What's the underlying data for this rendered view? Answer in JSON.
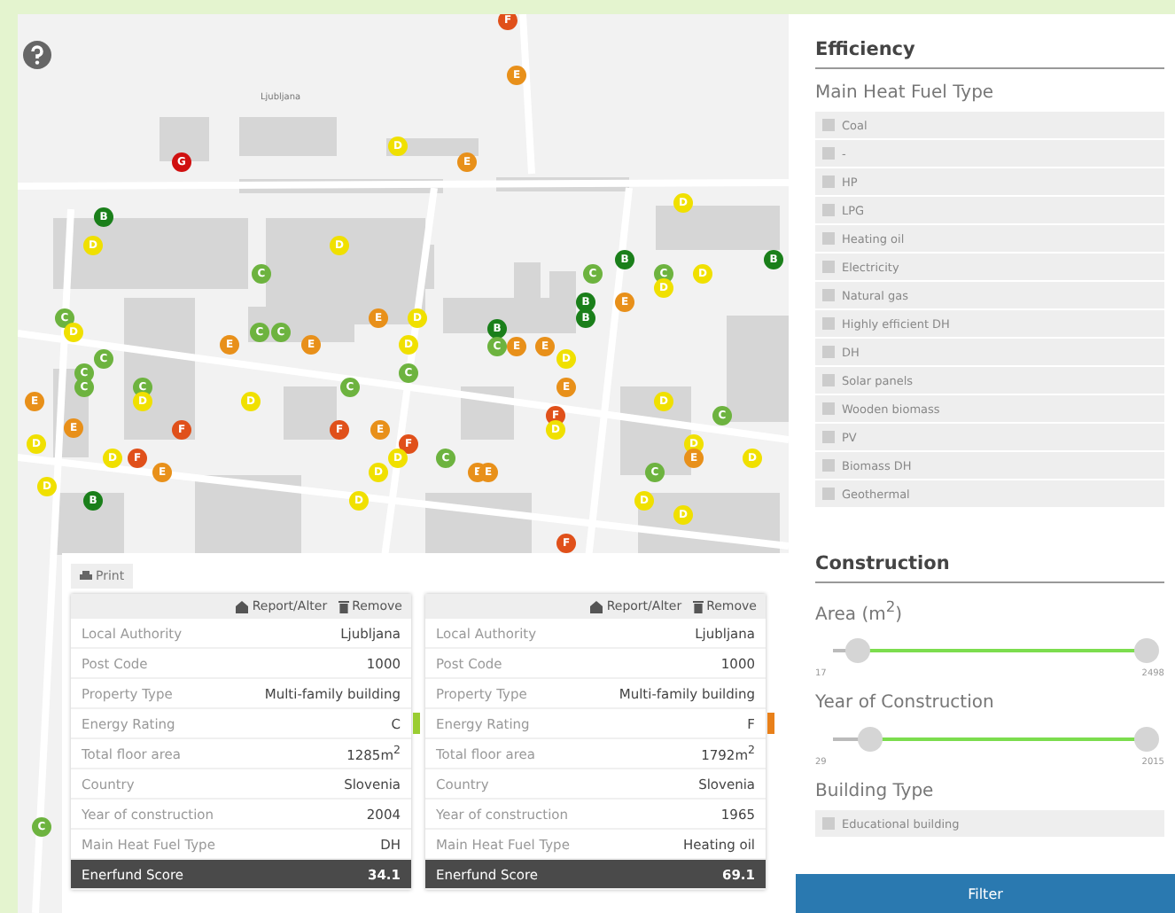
{
  "map": {
    "place_label": "Ljubljana",
    "markers": [
      {
        "label": "F",
        "color": "#e0501a"
      },
      {
        "label": "E",
        "color": "#e8901a"
      },
      {
        "label": "D",
        "color": "#f0e000"
      },
      {
        "label": "G",
        "color": "#d01010"
      },
      {
        "label": "E",
        "color": "#e8901a"
      },
      {
        "label": "D",
        "color": "#f0e000"
      },
      {
        "label": "B",
        "color": "#1a7f1a"
      },
      {
        "label": "D",
        "color": "#f0e000"
      },
      {
        "label": "D",
        "color": "#f0e000"
      },
      {
        "label": "B",
        "color": "#1a7f1a"
      },
      {
        "label": "B",
        "color": "#1a7f1a"
      },
      {
        "label": "C",
        "color": "#6db33f"
      },
      {
        "label": "C",
        "color": "#6db33f"
      },
      {
        "label": "C",
        "color": "#6db33f"
      },
      {
        "label": "D",
        "color": "#f0e000"
      },
      {
        "label": "D",
        "color": "#f0e000"
      },
      {
        "label": "B",
        "color": "#1a7f1a"
      },
      {
        "label": "E",
        "color": "#e8901a"
      },
      {
        "label": "C",
        "color": "#6db33f"
      },
      {
        "label": "E",
        "color": "#e8901a"
      },
      {
        "label": "D",
        "color": "#f0e000"
      },
      {
        "label": "B",
        "color": "#1a7f1a"
      },
      {
        "label": "B",
        "color": "#1a7f1a"
      },
      {
        "label": "D",
        "color": "#f0e000"
      },
      {
        "label": "C",
        "color": "#6db33f"
      },
      {
        "label": "C",
        "color": "#6db33f"
      },
      {
        "label": "E",
        "color": "#e8901a"
      },
      {
        "label": "E",
        "color": "#e8901a"
      },
      {
        "label": "D",
        "color": "#f0e000"
      },
      {
        "label": "C",
        "color": "#6db33f"
      },
      {
        "label": "E",
        "color": "#e8901a"
      },
      {
        "label": "E",
        "color": "#e8901a"
      },
      {
        "label": "C",
        "color": "#6db33f"
      },
      {
        "label": "D",
        "color": "#f0e000"
      },
      {
        "label": "C",
        "color": "#6db33f"
      },
      {
        "label": "C",
        "color": "#6db33f"
      },
      {
        "label": "C",
        "color": "#6db33f"
      },
      {
        "label": "C",
        "color": "#6db33f"
      },
      {
        "label": "C",
        "color": "#6db33f"
      },
      {
        "label": "E",
        "color": "#e8901a"
      },
      {
        "label": "E",
        "color": "#e8901a"
      },
      {
        "label": "D",
        "color": "#f0e000"
      },
      {
        "label": "D",
        "color": "#f0e000"
      },
      {
        "label": "D",
        "color": "#f0e000"
      },
      {
        "label": "F",
        "color": "#e0501a"
      },
      {
        "label": "C",
        "color": "#6db33f"
      },
      {
        "label": "E",
        "color": "#e8901a"
      },
      {
        "label": "F",
        "color": "#e0501a"
      },
      {
        "label": "F",
        "color": "#e0501a"
      },
      {
        "label": "E",
        "color": "#e8901a"
      },
      {
        "label": "D",
        "color": "#f0e000"
      },
      {
        "label": "D",
        "color": "#f0e000"
      },
      {
        "label": "F",
        "color": "#e0501a"
      },
      {
        "label": "D",
        "color": "#f0e000"
      },
      {
        "label": "D",
        "color": "#f0e000"
      },
      {
        "label": "F",
        "color": "#e0501a"
      },
      {
        "label": "D",
        "color": "#f0e000"
      },
      {
        "label": "C",
        "color": "#6db33f"
      },
      {
        "label": "E",
        "color": "#e8901a"
      },
      {
        "label": "D",
        "color": "#f0e000"
      },
      {
        "label": "E",
        "color": "#e8901a"
      },
      {
        "label": "D",
        "color": "#f0e000"
      },
      {
        "label": "E",
        "color": "#e8901a"
      },
      {
        "label": "E",
        "color": "#e8901a"
      },
      {
        "label": "C",
        "color": "#6db33f"
      },
      {
        "label": "D",
        "color": "#f0e000"
      },
      {
        "label": "B",
        "color": "#1a7f1a"
      },
      {
        "label": "D",
        "color": "#f0e000"
      },
      {
        "label": "D",
        "color": "#f0e000"
      },
      {
        "label": "D",
        "color": "#f0e000"
      },
      {
        "label": "F",
        "color": "#e0501a"
      },
      {
        "label": "C",
        "color": "#6db33f"
      }
    ]
  },
  "results": {
    "print": "Print",
    "cards": [
      {
        "report": "Report/Alter",
        "remove": "Remove",
        "rows": [
          {
            "kind": "plain",
            "label": "Local Authority",
            "value": "Ljubljana"
          },
          {
            "kind": "plain",
            "label": "Post Code",
            "value": "1000"
          },
          {
            "kind": "plain",
            "label": "Property Type",
            "value": "Multi-family building"
          },
          {
            "kind": "rating",
            "label": "Energy Rating",
            "value": "C",
            "color": "#9acd32"
          },
          {
            "kind": "plain",
            "label": "Total floor area",
            "value": "1285m$^{2}$"
          },
          {
            "kind": "plain",
            "label": "Country",
            "value": "Slovenia"
          },
          {
            "kind": "plain",
            "label": "Year of construction",
            "value": "2004"
          },
          {
            "kind": "plain",
            "label": "Main Heat Fuel Type",
            "value": "DH"
          },
          {
            "kind": "score",
            "label": "Enerfund Score",
            "value": "34.1"
          }
        ]
      },
      {
        "report": "Report/Alter",
        "remove": "Remove",
        "rows": [
          {
            "kind": "plain",
            "label": "Local Authority",
            "value": "Ljubljana"
          },
          {
            "kind": "plain",
            "label": "Post Code",
            "value": "1000"
          },
          {
            "kind": "plain",
            "label": "Property Type",
            "value": "Multi-family building"
          },
          {
            "kind": "rating",
            "label": "Energy Rating",
            "value": "F",
            "color": "#e8801a"
          },
          {
            "kind": "plain",
            "label": "Total floor area",
            "value": "1792m$^{2}$"
          },
          {
            "kind": "plain",
            "label": "Country",
            "value": "Slovenia"
          },
          {
            "kind": "plain",
            "label": "Year of construction",
            "value": "1965"
          },
          {
            "kind": "plain",
            "label": "Main Heat Fuel Type",
            "value": "Heating oil"
          },
          {
            "kind": "score",
            "label": "Enerfund Score",
            "value": "69.1"
          }
        ]
      }
    ]
  },
  "sidebar": {
    "efficiency": {
      "title": "Efficiency",
      "fuel_title": "Main Heat Fuel Type",
      "fuels": [
        {
          "label": "Coal",
          "checked": false
        },
        {
          "label": "-",
          "checked": false
        },
        {
          "label": "HP",
          "checked": false
        },
        {
          "label": "LPG",
          "checked": false
        },
        {
          "label": "Heating oil",
          "checked": false
        },
        {
          "label": "Electricity",
          "checked": false
        },
        {
          "label": "Natural gas",
          "checked": false
        },
        {
          "label": "Highly efficient DH",
          "checked": false
        },
        {
          "label": "DH",
          "checked": false
        },
        {
          "label": "Solar panels",
          "checked": false
        },
        {
          "label": "Wooden biomass",
          "checked": false
        },
        {
          "label": "PV",
          "checked": false
        },
        {
          "label": "Biomass DH",
          "checked": false
        },
        {
          "label": "Geothermal",
          "checked": false
        }
      ]
    },
    "construction": {
      "title": "Construction",
      "sliders": [
        {
          "label": "Area (m$^{2}$)",
          "min": "17",
          "max": "2498",
          "thumbs": [
            {
              "level": 0.08
            },
            {
              "level": 1
            }
          ]
        },
        {
          "label": "Year of Construction",
          "min": "29",
          "max": "2015",
          "thumbs": [
            {
              "level": 0.12
            },
            {
              "level": 1
            }
          ]
        }
      ],
      "building_title": "Building Type",
      "building_types": [
        {
          "label": "Educational building",
          "checked": false
        }
      ]
    },
    "filter": "Filter"
  }
}
